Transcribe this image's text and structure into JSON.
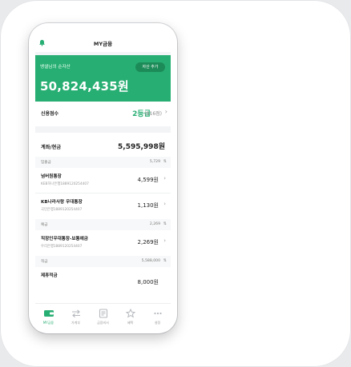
{
  "header": {
    "title": "MY금융"
  },
  "hero": {
    "label": "뱅샐님의 순자산",
    "add_button": "자산 추가",
    "amount": "50,824,435원"
  },
  "credit": {
    "label": "신용점수",
    "grade": "2등급",
    "points": "(916점)"
  },
  "accounts": {
    "total_label": "계좌/현금",
    "total_value": "5,595,998원",
    "sections": [
      {
        "label": "입출금",
        "value": "5,729"
      },
      {
        "label": "예금",
        "value": "2,269"
      },
      {
        "label": "적금",
        "value": "5,588,000"
      }
    ],
    "items": [
      {
        "name": "넘버원통장",
        "sub": "KEB하나은행1889120254407",
        "amount": "4,599원"
      },
      {
        "name": "KB나라사랑 우대통장",
        "sub": "국민은행1889120254407",
        "amount": "1,130원"
      },
      {
        "name": "직장인우대통장-보통예금",
        "sub": "우리은행1889120254407",
        "amount": "2,269원"
      },
      {
        "name": "제휴적금",
        "sub": "",
        "amount": "8,000원"
      }
    ]
  },
  "nav": [
    {
      "label": "MY금융",
      "icon": "wallet-icon",
      "active": true
    },
    {
      "label": "가계부",
      "icon": "transfer-icon",
      "active": false
    },
    {
      "label": "금융비서",
      "icon": "report-icon",
      "active": false
    },
    {
      "label": "혜택",
      "icon": "star-icon",
      "active": false
    },
    {
      "label": "설정",
      "icon": "more-icon",
      "active": false
    }
  ],
  "colors": {
    "brand": "#27ae72",
    "brand_dark": "#1c8b58"
  }
}
